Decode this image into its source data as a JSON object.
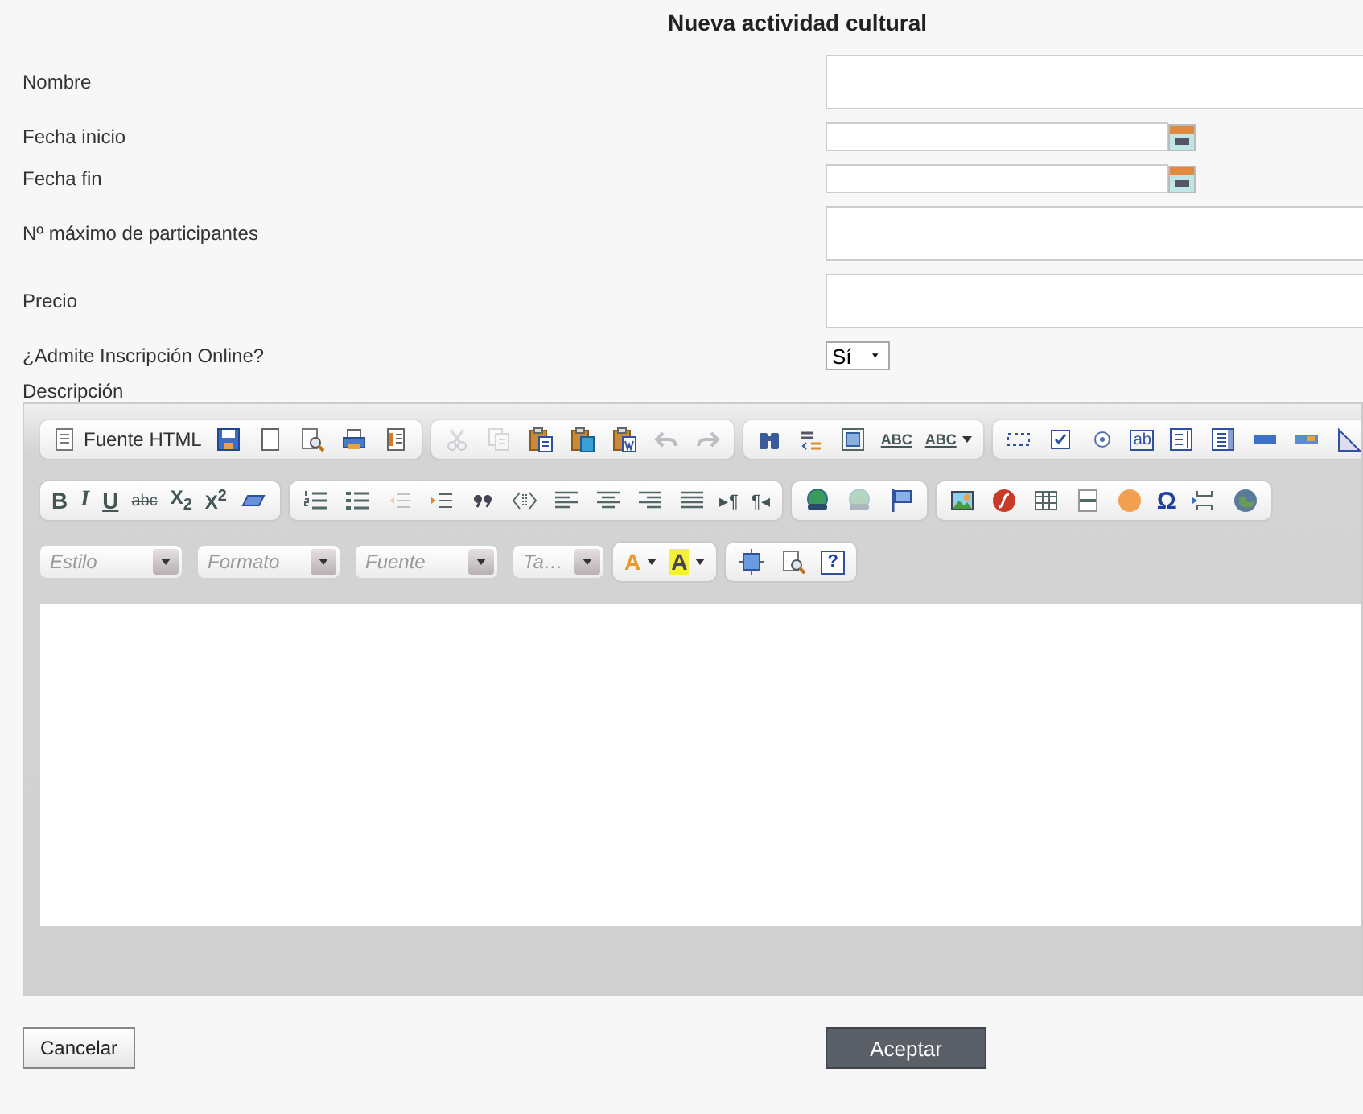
{
  "title": "Nueva actividad cultural",
  "fields": [
    {
      "kind": "text",
      "label": "Nombre"
    },
    {
      "kind": "date",
      "label": "Fecha inicio"
    },
    {
      "kind": "date",
      "label": "Fecha fin"
    },
    {
      "kind": "text",
      "label": "Nº máximo de participantes"
    },
    {
      "kind": "text",
      "label": "Precio"
    },
    {
      "kind": "select",
      "label": "¿Admite Inscripción Online?",
      "value": "Sí"
    }
  ],
  "description": {
    "label": "Descripción",
    "toolbar": [
      [
        [
          {
            "label": "Fuente HTML",
            "disabled": false
          },
          {
            "disabled": false
          },
          {
            "disabled": false
          },
          {
            "disabled": false
          },
          {
            "disabled": false
          },
          {
            "disabled": false
          }
        ],
        [
          {
            "disabled": true
          },
          {
            "disabled": true
          },
          {
            "disabled": false
          },
          {
            "disabled": false
          },
          {
            "disabled": false
          },
          {
            "disabled": true
          },
          {
            "disabled": true
          }
        ],
        [
          {
            "disabled": false
          },
          {
            "disabled": false
          },
          {
            "disabled": false
          },
          {
            "label": "ABC",
            "disabled": false
          },
          {
            "label": "ABC",
            "disabled": false
          }
        ],
        [
          {
            "disabled": false
          },
          {
            "disabled": false
          },
          {
            "disabled": false
          },
          {
            "label": "ab",
            "disabled": false
          },
          {
            "disabled": false
          },
          {
            "disabled": false
          },
          {
            "disabled": false
          },
          {
            "disabled": false
          },
          {
            "disabled": false
          }
        ]
      ],
      [
        [
          {
            "label": "B",
            "disabled": false
          },
          {
            "label": "I",
            "disabled": false
          },
          {
            "label": "U",
            "disabled": false
          },
          {
            "label": "abc",
            "disabled": false
          },
          {
            "label": "X$_{2}$",
            "disabled": false
          },
          {
            "label": "X$^{2}$",
            "disabled": false
          },
          {
            "disabled": false
          }
        ],
        [
          {
            "disabled": false
          },
          {
            "disabled": false
          },
          {
            "disabled": true
          },
          {
            "disabled": false
          },
          {
            "disabled": false
          },
          {
            "disabled": false
          },
          {
            "disabled": false
          },
          {
            "disabled": false
          },
          {
            "disabled": false
          },
          {
            "disabled": false
          },
          {
            "label": "▸¶",
            "disabled": false
          },
          {
            "label": "¶◂",
            "disabled": false
          }
        ],
        [
          {
            "disabled": false
          },
          {
            "disabled": true
          },
          {
            "disabled": false
          }
        ],
        [
          {
            "disabled": false
          },
          {
            "disabled": false
          },
          {
            "disabled": false
          },
          {
            "disabled": false
          },
          {
            "disabled": false
          },
          {
            "label": "Ω",
            "disabled": false
          },
          {
            "disabled": false
          },
          {
            "disabled": false
          }
        ]
      ],
      [
        [
          {
            "kind": "combo",
            "placeholder": "Estilo"
          },
          {
            "kind": "combo",
            "placeholder": "Formato"
          },
          {
            "kind": "combo",
            "placeholder": "Fuente"
          },
          {
            "kind": "combo",
            "placeholder": "Ta…"
          }
        ],
        [
          {
            "label": "A",
            "disabled": false
          },
          {
            "label": "A",
            "disabled": false
          }
        ],
        [
          {
            "disabled": false
          },
          {
            "disabled": false
          },
          {
            "label": "?",
            "disabled": false
          }
        ]
      ]
    ]
  },
  "buttons": [
    {
      "kind": "secondary",
      "label": "Cancelar"
    },
    {
      "kind": "primary",
      "label": "Aceptar"
    }
  ]
}
